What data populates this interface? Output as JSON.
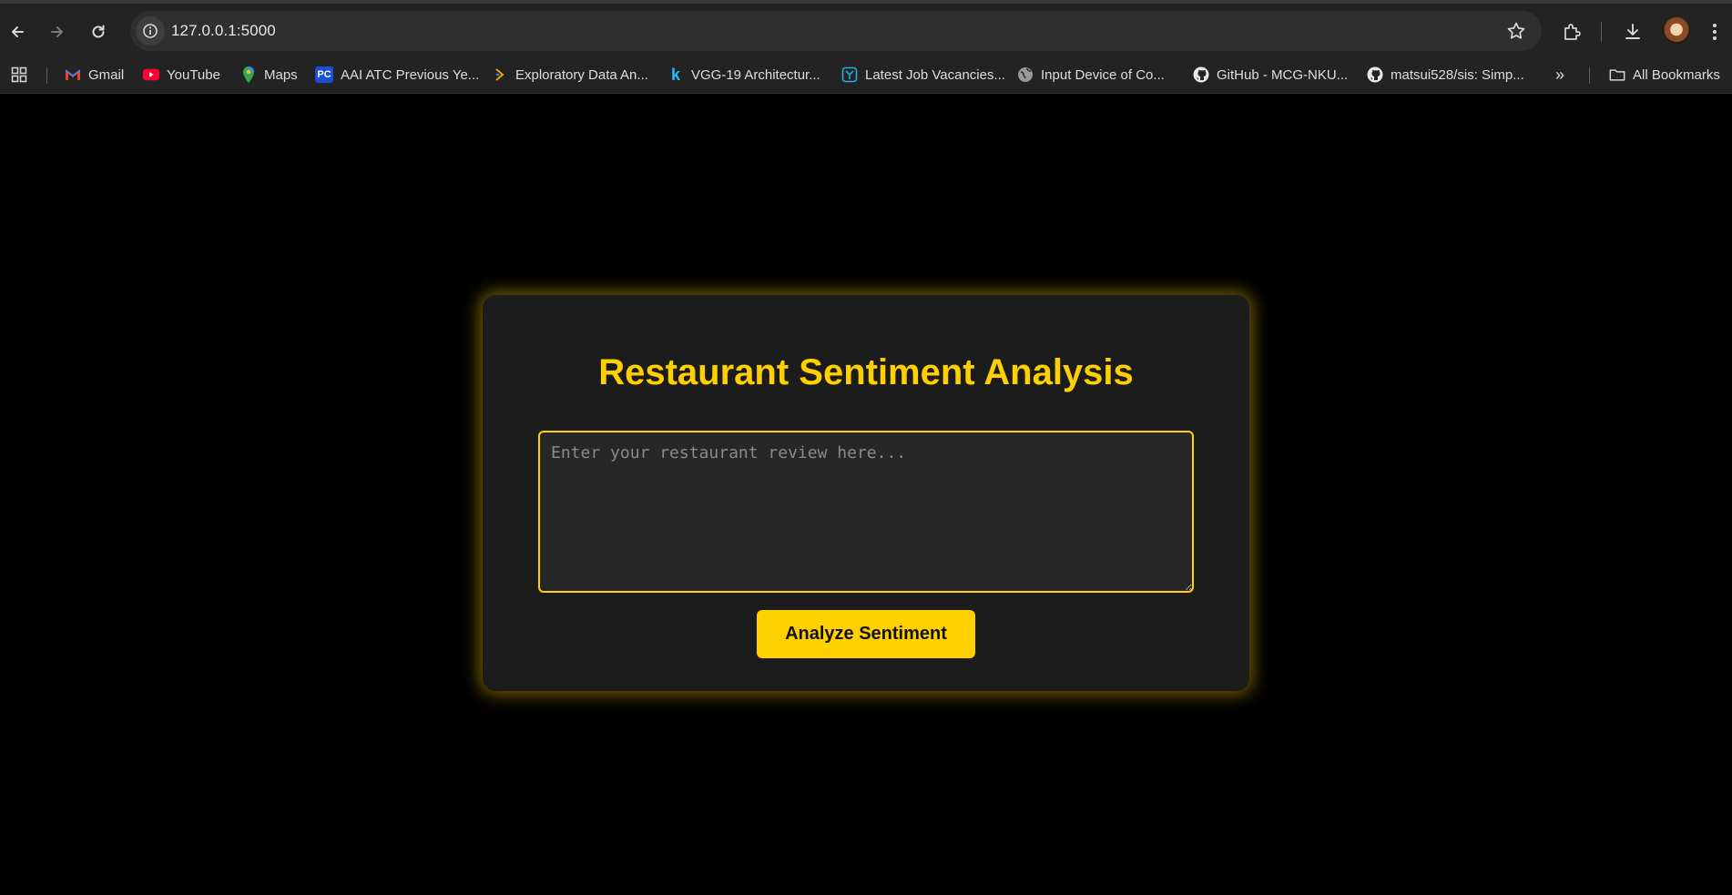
{
  "browser": {
    "url": "127.0.0.1:5000",
    "bookmarks": [
      {
        "label": "Gmail",
        "icon": "gmail-icon"
      },
      {
        "label": "YouTube",
        "icon": "youtube-icon"
      },
      {
        "label": "Maps",
        "icon": "maps-icon"
      },
      {
        "label": "AAI ATC Previous Ye...",
        "icon": "pc-icon"
      },
      {
        "label": "Exploratory Data An...",
        "icon": "kaggle-arrow-icon"
      },
      {
        "label": "VGG-19 Architectur...",
        "icon": "k-icon"
      },
      {
        "label": "Latest Job Vacancies...",
        "icon": "job-icon"
      },
      {
        "label": "Input Device of Co...",
        "icon": "globe-icon"
      },
      {
        "label": "GitHub - MCG-NKU...",
        "icon": "github-icon"
      },
      {
        "label": "matsui528/sis: Simp...",
        "icon": "github-icon"
      }
    ],
    "all_bookmarks_label": "All Bookmarks",
    "overflow_label": "»"
  },
  "app": {
    "title": "Restaurant Sentiment Analysis",
    "review_placeholder": "Enter your restaurant review here...",
    "analyze_button": "Analyze Sentiment"
  },
  "colors": {
    "accent": "#ffd000",
    "page_background": "#000000",
    "card_background": "#1c1c1c"
  }
}
